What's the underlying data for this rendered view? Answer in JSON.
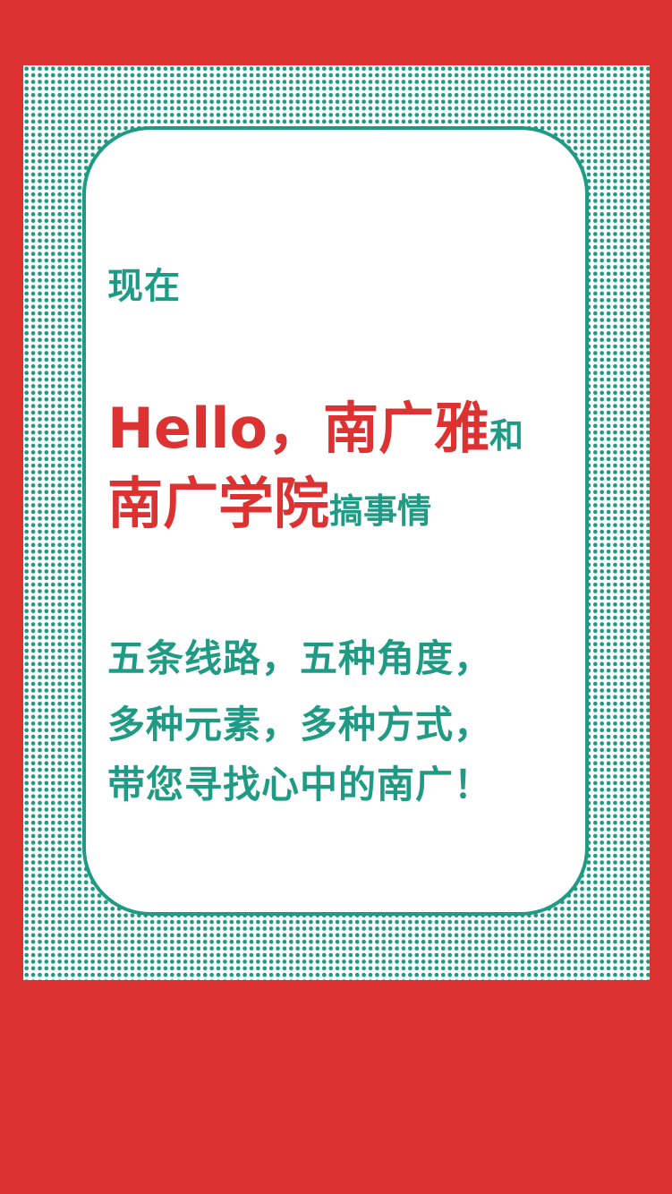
{
  "colors": {
    "background": "#dc3232",
    "accent_green": "#1f9a84",
    "accent_red": "#dc3232",
    "card": "#ffffff"
  },
  "intro": "现在",
  "headline": {
    "line1_main": "Hello，南广雅",
    "line1_tail": "和",
    "line2_main": "南广学院",
    "line2_tail": "搞事情"
  },
  "paragraph": {
    "line1": "五条线路，五种角度，",
    "line2": "多种元素，多种方式，",
    "line3": "带您寻找心中的南广！"
  }
}
